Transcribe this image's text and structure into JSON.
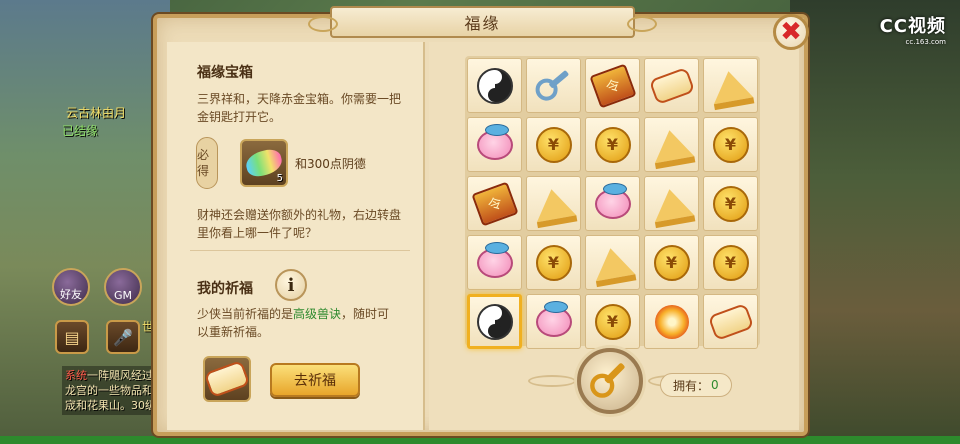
{
  "window": {
    "title": "福缘"
  },
  "watermark": {
    "brand": "CC视频",
    "sub": "cc.163.com"
  },
  "background": {
    "npc_name": "云古林由月",
    "npc_sub": "已结缘",
    "buttons": [
      {
        "label": "好友",
        "icon": "friends-icon"
      },
      {
        "label": "GM",
        "icon": "gm-icon"
      }
    ],
    "voice_label": "世",
    "chat_lines": [
      {
        "tag": "系统",
        "text": "一阵飓风经过"
      },
      {
        "tag": "",
        "text": "龙宫的一些物品和"
      },
      {
        "tag": "",
        "text": "宬和花果山。30级"
      }
    ]
  },
  "chest": {
    "title": "福缘宝箱",
    "description": "三界祥和，天降赤金宝箱。你需要一把金钥匙打开它。",
    "must_label": "必得",
    "must_item": {
      "name": "彩石",
      "count": "5",
      "icon": "colorful-stone-icon"
    },
    "must_text": "和300点阴德",
    "extra": "财神还会赠送你额外的礼物，右边转盘里你看上哪一件了呢？"
  },
  "wish": {
    "title": "我的祈福",
    "info_icon": "info-icon",
    "desc_prefix": "少侠当前祈福的是",
    "desc_highlight": "高级兽诀",
    "desc_suffix": "，随时可以重新祈福。",
    "item_icon": "scroll-icon",
    "button_label": "去祈福"
  },
  "grid": {
    "rows": [
      [
        "yinyang",
        "key",
        "seal",
        "scroll",
        "cheese"
      ],
      [
        "pig",
        "coin",
        "coin",
        "cheese",
        "coin"
      ],
      [
        "seal",
        "cheese",
        "pig",
        "cheese",
        "coin"
      ],
      [
        "pig",
        "coin",
        "cheese",
        "coin",
        "coin"
      ],
      [
        "yinyang",
        "pig",
        "coin",
        "fireball",
        "scroll"
      ]
    ],
    "selected_row": 4,
    "selected_col": 0
  },
  "key_button": {
    "icon": "golden-key-icon"
  },
  "owned": {
    "label": "拥有：",
    "value": "0"
  },
  "colors": {
    "accent": "#e8a52a",
    "highlight": "#2e8a2e",
    "close": "#d8282a"
  }
}
